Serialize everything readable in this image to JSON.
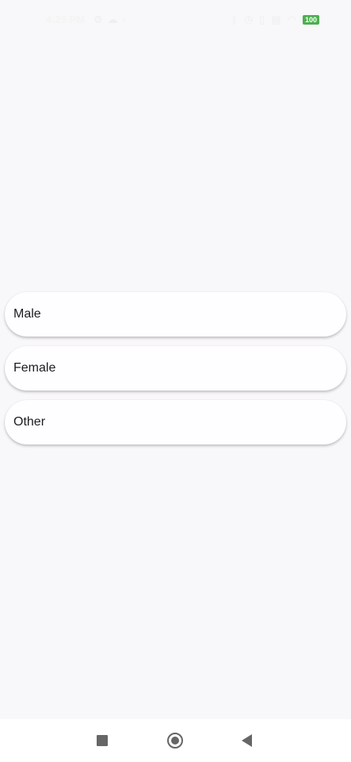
{
  "status_bar": {
    "time": "4:25 PM",
    "left_icons": [
      "settings-icon",
      "cloud-icon",
      "sim-icon"
    ],
    "right_icons": [
      "bluetooth-icon",
      "alarm-icon",
      "vibrate-icon",
      "network-icon",
      "wifi-icon"
    ],
    "battery": "100"
  },
  "options": [
    {
      "label": "Male"
    },
    {
      "label": "Female"
    },
    {
      "label": "Other"
    }
  ],
  "nav_bar": {
    "buttons": [
      "recents-button",
      "home-button",
      "back-button"
    ]
  },
  "colors": {
    "background": "#f8f7f9",
    "option_background": "#fefdff",
    "battery": "#4caf50",
    "nav_icon": "#666666"
  }
}
